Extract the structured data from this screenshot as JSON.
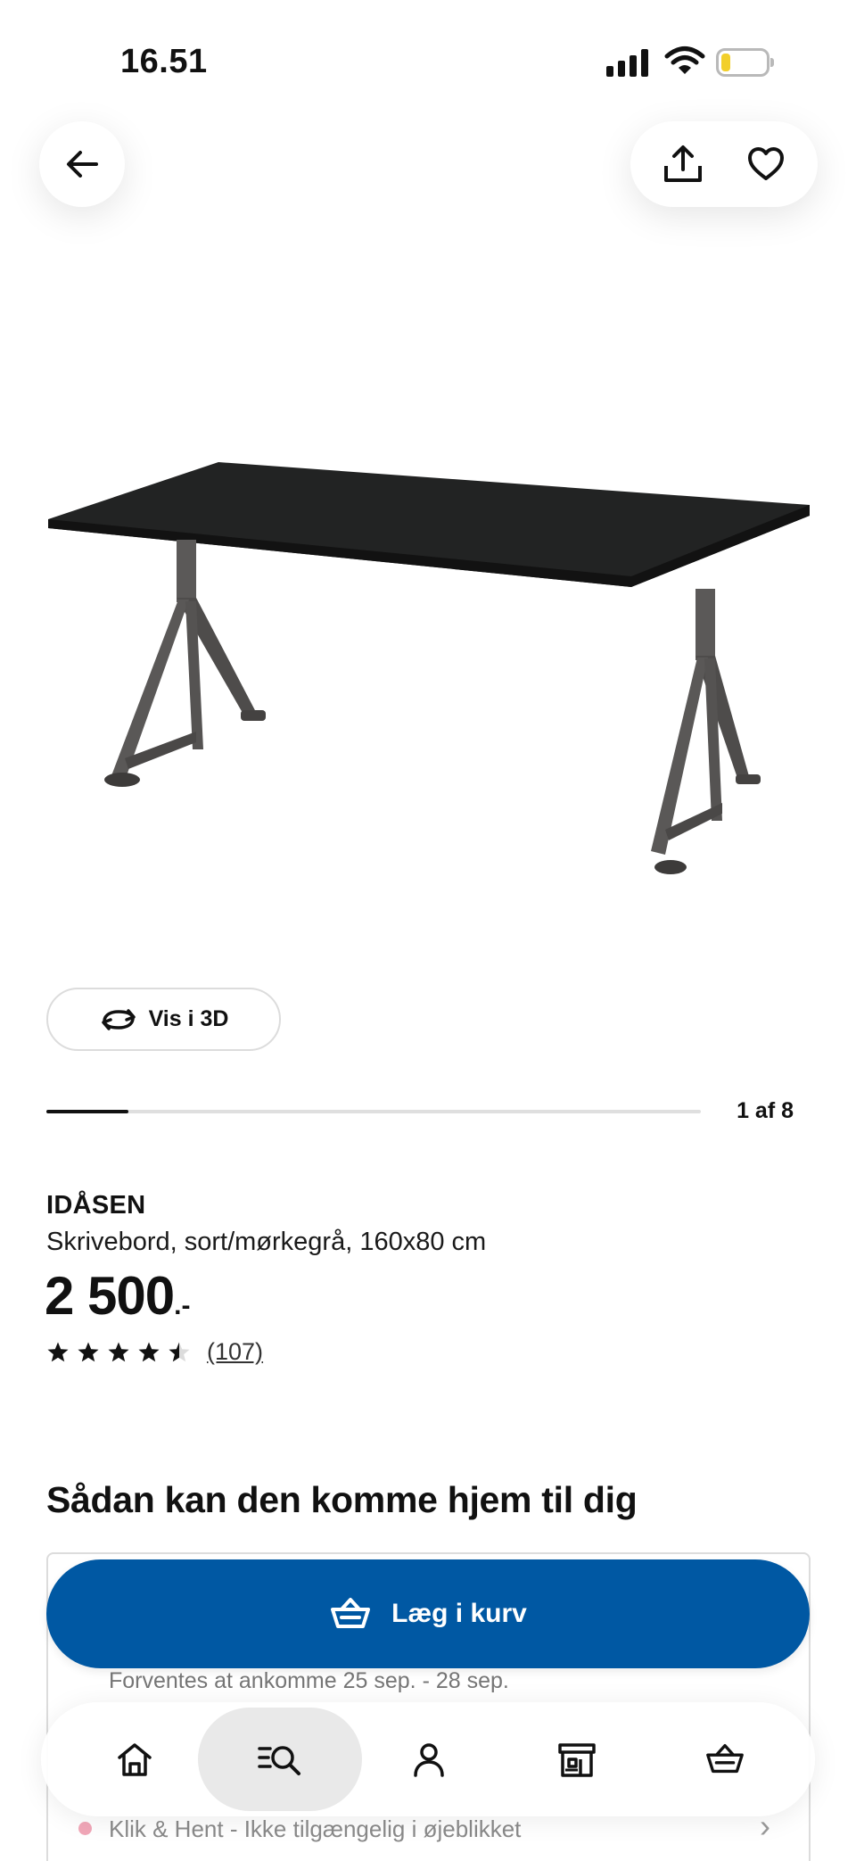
{
  "status_bar": {
    "time": "16.51"
  },
  "top_actions": {
    "back_icon": "arrow-left-icon",
    "share_icon": "share-icon",
    "favourite_icon": "heart-icon"
  },
  "gallery": {
    "view_3d_label": "Vis i 3D",
    "current": 1,
    "total": 8,
    "counter_label": "1 af 8"
  },
  "product": {
    "name": "IDÅSEN",
    "description": "Skrivebord, sort/mørkegrå, 160x80 cm",
    "price": "2 500",
    "price_suffix": ".-",
    "rating_value": 4.5,
    "rating_count": "(107)"
  },
  "delivery": {
    "section_title": "Sådan kan den komme hjem til dig",
    "eta": "Forventes at ankomme 25 sep. - 28 sep.",
    "click_collect_status": "Klik & Hent - Ikke tilgængelig i øjeblikket"
  },
  "cta": {
    "add_to_cart_label": "Læg i kurv",
    "color": "#0058a3"
  },
  "tabbar": {
    "items": [
      {
        "name": "home",
        "icon": "home-icon",
        "active": false
      },
      {
        "name": "search",
        "icon": "search-icon",
        "active": true
      },
      {
        "name": "profile",
        "icon": "profile-icon",
        "active": false
      },
      {
        "name": "stores",
        "icon": "store-icon",
        "active": false
      },
      {
        "name": "basket",
        "icon": "basket-icon",
        "active": false
      }
    ]
  }
}
